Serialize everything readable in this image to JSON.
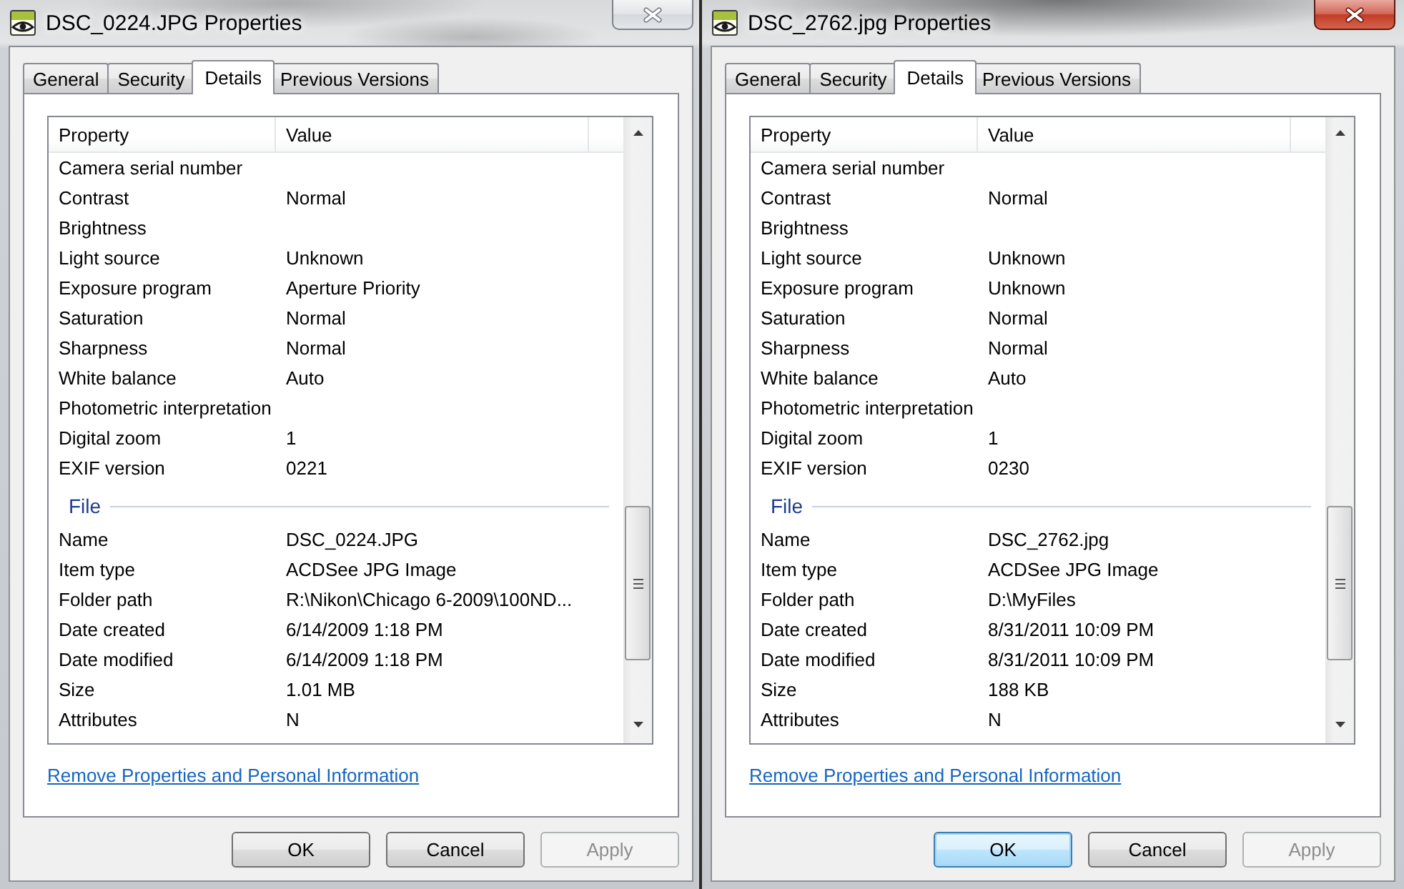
{
  "windows": [
    {
      "title": "DSC_0224.JPG Properties",
      "active": false,
      "tabs": [
        {
          "label": "General",
          "selected": false
        },
        {
          "label": "Security",
          "selected": false
        },
        {
          "label": "Details",
          "selected": true
        },
        {
          "label": "Previous Versions",
          "selected": false
        }
      ],
      "columns": [
        "Property",
        "Value"
      ],
      "groups": [
        {
          "rows": [
            {
              "property": "Camera serial number"
            },
            {
              "property": "Contrast",
              "value": "Normal"
            },
            {
              "property": "Brightness"
            },
            {
              "property": "Light source",
              "value": "Unknown"
            },
            {
              "property": "Exposure program",
              "value": "Aperture Priority"
            },
            {
              "property": "Saturation",
              "value": "Normal"
            },
            {
              "property": "Sharpness",
              "value": "Normal"
            },
            {
              "property": "White balance",
              "value": "Auto"
            },
            {
              "property": "Photometric interpretation"
            },
            {
              "property": "Digital zoom",
              "value": "1"
            },
            {
              "property": "EXIF version",
              "value": "0221"
            }
          ]
        },
        {
          "heading": "File",
          "rows": [
            {
              "property": "Name",
              "value": "DSC_0224.JPG"
            },
            {
              "property": "Item type",
              "value": "ACDSee JPG Image"
            },
            {
              "property": "Folder path",
              "value": "R:\\Nikon\\Chicago 6-2009\\100ND..."
            },
            {
              "property": "Date created",
              "value": "6/14/2009 1:18 PM"
            },
            {
              "property": "Date modified",
              "value": "6/14/2009 1:18 PM"
            },
            {
              "property": "Size",
              "value": "1.01 MB"
            },
            {
              "property": "Attributes",
              "value": "N"
            }
          ]
        }
      ],
      "link": "Remove Properties and Personal Information",
      "buttons": [
        {
          "label": "OK",
          "focused": false,
          "disabled": false
        },
        {
          "label": "Cancel",
          "focused": false,
          "disabled": false
        },
        {
          "label": "Apply",
          "focused": false,
          "disabled": true
        }
      ]
    },
    {
      "title": "DSC_2762.jpg Properties",
      "active": true,
      "tabs": [
        {
          "label": "General",
          "selected": false
        },
        {
          "label": "Security",
          "selected": false
        },
        {
          "label": "Details",
          "selected": true
        },
        {
          "label": "Previous Versions",
          "selected": false
        }
      ],
      "columns": [
        "Property",
        "Value"
      ],
      "groups": [
        {
          "rows": [
            {
              "property": "Camera serial number"
            },
            {
              "property": "Contrast",
              "value": "Normal"
            },
            {
              "property": "Brightness"
            },
            {
              "property": "Light source",
              "value": "Unknown"
            },
            {
              "property": "Exposure program",
              "value": "Unknown"
            },
            {
              "property": "Saturation",
              "value": "Normal"
            },
            {
              "property": "Sharpness",
              "value": "Normal"
            },
            {
              "property": "White balance",
              "value": "Auto"
            },
            {
              "property": "Photometric interpretation"
            },
            {
              "property": "Digital zoom",
              "value": "1"
            },
            {
              "property": "EXIF version",
              "value": "0230"
            }
          ]
        },
        {
          "heading": "File",
          "rows": [
            {
              "property": "Name",
              "value": "DSC_2762.jpg"
            },
            {
              "property": "Item type",
              "value": "ACDSee JPG Image"
            },
            {
              "property": "Folder path",
              "value": "D:\\MyFiles"
            },
            {
              "property": "Date created",
              "value": "8/31/2011 10:09 PM"
            },
            {
              "property": "Date modified",
              "value": "8/31/2011 10:09 PM"
            },
            {
              "property": "Size",
              "value": "188 KB"
            },
            {
              "property": "Attributes",
              "value": "N"
            }
          ]
        }
      ],
      "link": "Remove Properties and Personal Information",
      "buttons": [
        {
          "label": "OK",
          "focused": true,
          "disabled": false
        },
        {
          "label": "Cancel",
          "focused": false,
          "disabled": false
        },
        {
          "label": "Apply",
          "focused": false,
          "disabled": true
        }
      ]
    }
  ]
}
